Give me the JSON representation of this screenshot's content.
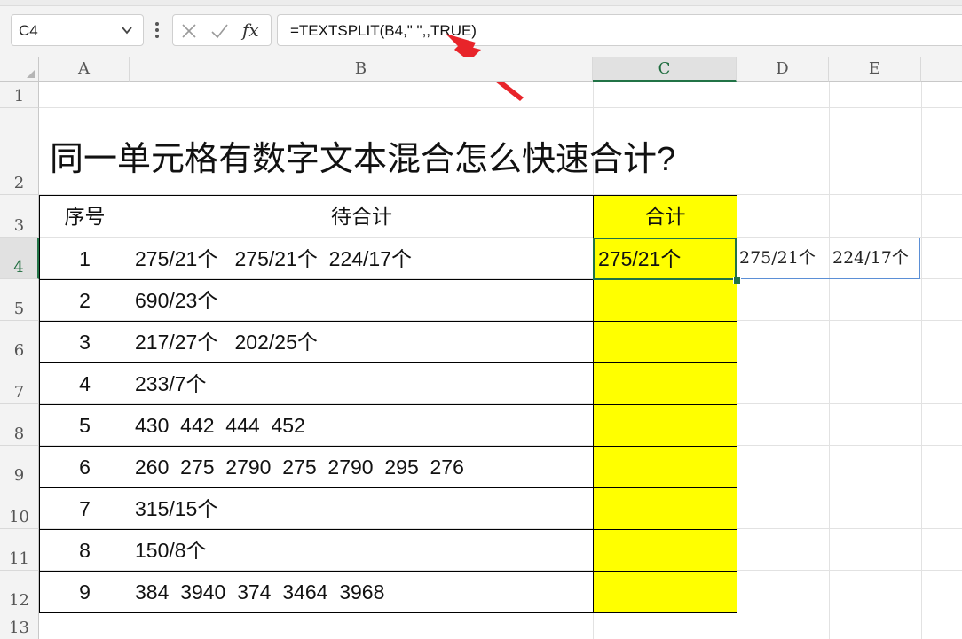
{
  "formula_bar": {
    "name_box": "C4",
    "formula": "=TEXTSPLIT(B4,\" \",,TRUE)",
    "fx_label": "fx",
    "icons": [
      "chevron-down-icon",
      "more-vertical-icon",
      "cancel-icon",
      "check-icon",
      "function-icon"
    ]
  },
  "columns": [
    "A",
    "B",
    "C",
    "D",
    "E"
  ],
  "selected_column": "C",
  "rows": [
    "1",
    "2",
    "3",
    "4",
    "5",
    "6",
    "7",
    "8",
    "9",
    "10",
    "11",
    "12",
    "13"
  ],
  "selected_row": "4",
  "title": "同一单元格有数字文本混合怎么快速合计?",
  "table": {
    "headers": [
      "序号",
      "待合计",
      "合计"
    ],
    "rows": [
      {
        "no": "1",
        "text": "275/21个   275/21个  224/17个",
        "total": "275/21个"
      },
      {
        "no": "2",
        "text": "690/23个",
        "total": ""
      },
      {
        "no": "3",
        "text": "217/27个   202/25个",
        "total": ""
      },
      {
        "no": "4",
        "text": "233/7个",
        "total": ""
      },
      {
        "no": "5",
        "text": "430  442  444  452",
        "total": ""
      },
      {
        "no": "6",
        "text": "260  275  2790  275  2790  295  276",
        "total": ""
      },
      {
        "no": "7",
        "text": "315/15个",
        "total": ""
      },
      {
        "no": "8",
        "text": "150/8个",
        "total": ""
      },
      {
        "no": "9",
        "text": "384  3940  374  3464  3968",
        "total": ""
      }
    ]
  },
  "spill": {
    "d4": "275/21个",
    "e4": "224/17个"
  },
  "colors": {
    "highlight": "#ffff00",
    "selection": "#217346",
    "arrow": "#e8242a",
    "spill_border": "#5b8fd6"
  }
}
